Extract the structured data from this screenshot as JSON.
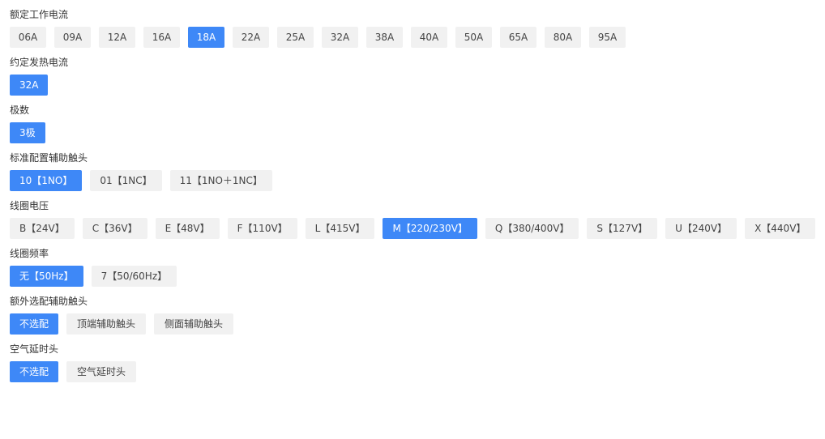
{
  "groups": [
    {
      "title": "额定工作电流",
      "options": [
        "06A",
        "09A",
        "12A",
        "16A",
        "18A",
        "22A",
        "25A",
        "32A",
        "38A",
        "40A",
        "50A",
        "65A",
        "80A",
        "95A"
      ],
      "selected": 4
    },
    {
      "title": "约定发热电流",
      "options": [
        "32A"
      ],
      "selected": 0
    },
    {
      "title": "极数",
      "options": [
        "3极"
      ],
      "selected": 0
    },
    {
      "title": "标准配置辅助触头",
      "options": [
        "10【1NO】",
        "01【1NC】",
        "11【1NO＋1NC】"
      ],
      "selected": 0
    },
    {
      "title": "线圈电压",
      "options": [
        "B【24V】",
        "C【36V】",
        "E【48V】",
        "F【110V】",
        "L【415V】",
        "M【220/230V】",
        "Q【380/400V】",
        "S【127V】",
        "U【240V】",
        "X【440V】"
      ],
      "selected": 5
    },
    {
      "title": "线圈频率",
      "options": [
        "无【50Hz】",
        "7【50/60Hz】"
      ],
      "selected": 0
    },
    {
      "title": "额外选配辅助触头",
      "options": [
        "不选配",
        "顶端辅助触头",
        "侧面辅助触头"
      ],
      "selected": 0
    },
    {
      "title": "空气延时头",
      "options": [
        "不选配",
        "空气延时头"
      ],
      "selected": 0
    }
  ],
  "colors": {
    "selected_bg": "#3e88f7",
    "selected_text": "#ffffff",
    "option_bg": "#f1f1f1",
    "option_text": "#444444",
    "title_text": "#333333"
  }
}
